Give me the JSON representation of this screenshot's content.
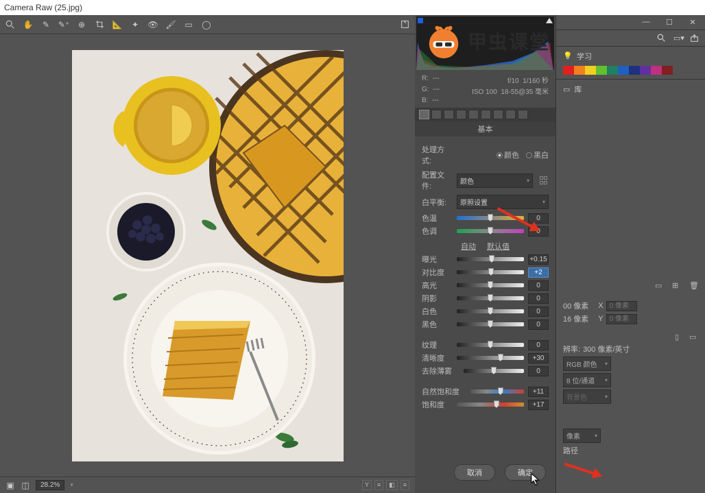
{
  "title": "Camera Raw (25.jpg)",
  "exif": {
    "r": "R:",
    "g": "G:",
    "b": "B:",
    "r_val": "---",
    "g_val": "---",
    "b_val": "---",
    "aperture": "f/10",
    "shutter": "1/160 秒",
    "iso": "ISO 100",
    "lens": "18-55@35 毫米"
  },
  "panel_title": "基本",
  "treatment": {
    "label": "处理方式:",
    "opt_color": "颜色",
    "opt_bw": "黑白"
  },
  "profile": {
    "label": "配置文件:",
    "value": "颜色"
  },
  "wb": {
    "label": "白平衡:",
    "value": "原照设置"
  },
  "sliders": {
    "temp": {
      "label": "色温",
      "value": "0"
    },
    "tint": {
      "label": "色调",
      "value": "0"
    },
    "auto": "自动",
    "default": "默认值",
    "exposure": {
      "label": "曝光",
      "value": "+0.15"
    },
    "contrast": {
      "label": "对比度",
      "value": "+2"
    },
    "highlights": {
      "label": "高光",
      "value": "0"
    },
    "shadows": {
      "label": "阴影",
      "value": "0"
    },
    "whites": {
      "label": "白色",
      "value": "0"
    },
    "blacks": {
      "label": "黑色",
      "value": "0"
    },
    "texture": {
      "label": "纹理",
      "value": "0"
    },
    "clarity": {
      "label": "清晰度",
      "value": "+30"
    },
    "dehaze": {
      "label": "去除薄雾",
      "value": "0"
    },
    "vibrance": {
      "label": "自然饱和度",
      "value": "+11"
    },
    "saturation": {
      "label": "饱和度",
      "value": "+17"
    }
  },
  "buttons": {
    "cancel": "取消",
    "ok": "确定"
  },
  "zoom": "28.2%",
  "right": {
    "learn": "学习",
    "library": "库",
    "px_w": "00 像素",
    "px_h": "16 像素",
    "x": "X",
    "y": "Y",
    "res_label": "辨率:",
    "res_val": "300 像素/英寸",
    "mode": "RGB 颜色",
    "bits": "8 位/通道",
    "bg": "背景色",
    "unit": "像素",
    "paths": "路径"
  },
  "logo_text": "甲虫课堂",
  "x_ph": "0 像素",
  "y_ph": "0 像素"
}
